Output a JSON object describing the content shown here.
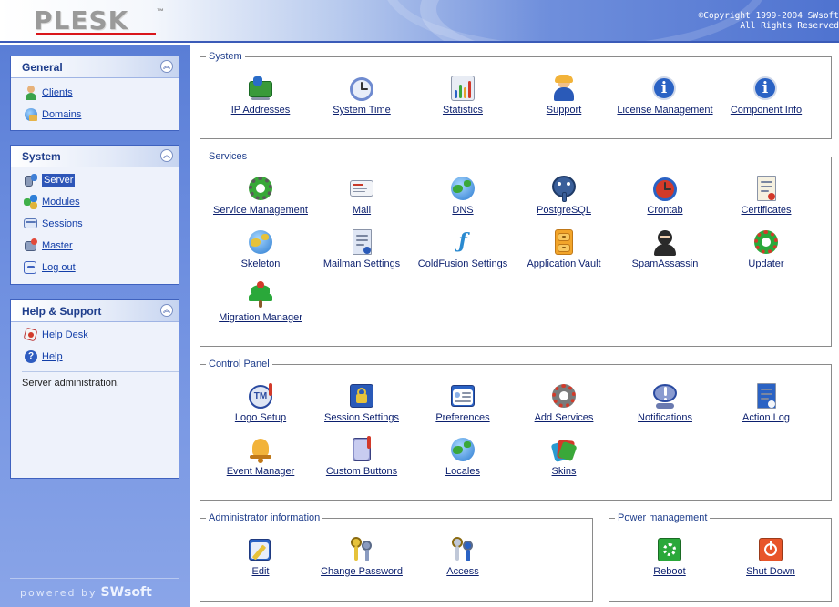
{
  "header": {
    "logo": "PLESK",
    "logo_tm": "™",
    "copyright_line1": "©Copyright 1999-2004 SWsoft",
    "copyright_line2": "All Rights Reserved"
  },
  "sidebar": {
    "general": {
      "title": "General",
      "items": [
        {
          "label": "Clients",
          "icon": "clients-icon"
        },
        {
          "label": "Domains",
          "icon": "domains-icon"
        }
      ]
    },
    "system": {
      "title": "System",
      "items": [
        {
          "label": "Server",
          "icon": "server-icon",
          "active": true
        },
        {
          "label": "Modules",
          "icon": "modules-icon"
        },
        {
          "label": "Sessions",
          "icon": "sessions-icon"
        },
        {
          "label": "Master",
          "icon": "master-icon"
        },
        {
          "label": "Log out",
          "icon": "logout-icon"
        }
      ]
    },
    "help": {
      "title": "Help & Support",
      "items": [
        {
          "label": "Help Desk",
          "icon": "help-desk-icon"
        },
        {
          "label": "Help",
          "icon": "help-icon"
        }
      ],
      "note": "Server administration."
    },
    "powered_by": "powered by",
    "powered_brand": "SWsoft"
  },
  "groups": {
    "system": {
      "title": "System",
      "items": [
        "IP Addresses",
        "System Time",
        "Statistics",
        "Support",
        "License Management",
        "Component Info"
      ]
    },
    "services": {
      "title": "Services",
      "items": [
        "Service Management",
        "Mail",
        "DNS",
        "PostgreSQL",
        "Crontab",
        "Certificates",
        "Skeleton",
        "Mailman Settings",
        "ColdFusion Settings",
        "Application Vault",
        "SpamAssassin",
        "Updater",
        "Migration Manager"
      ]
    },
    "control_panel": {
      "title": "Control Panel",
      "items": [
        "Logo Setup",
        "Session Settings",
        "Preferences",
        "Add Services",
        "Notifications",
        "Action Log",
        "Event Manager",
        "Custom Buttons",
        "Locales",
        "Skins"
      ]
    },
    "admin": {
      "title": "Administrator information",
      "items": [
        "Edit",
        "Change Password",
        "Access"
      ]
    },
    "power": {
      "title": "Power management",
      "items": [
        "Reboot",
        "Shut Down"
      ]
    }
  },
  "colors": {
    "accent": "#1f3e8c",
    "link": "#0b1f6e",
    "sidebar": "#6e8fe0",
    "logo_red": "#d9161c"
  }
}
